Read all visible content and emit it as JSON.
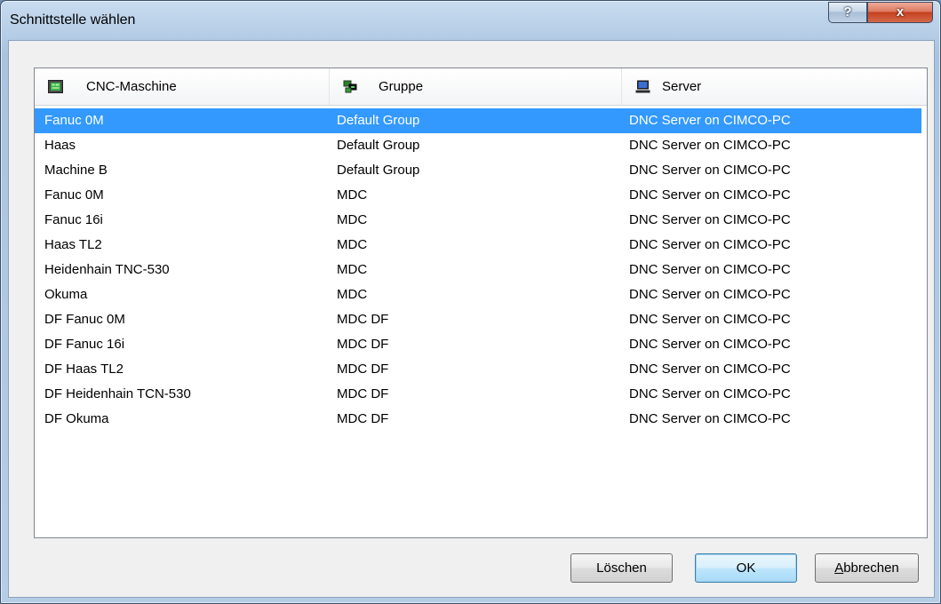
{
  "window": {
    "title": "Schnittstelle wählen",
    "help_label": "?",
    "close_label": "x"
  },
  "columns": [
    {
      "label": "CNC-Maschine",
      "icon": "cnc-machine-icon"
    },
    {
      "label": "Gruppe",
      "icon": "group-icon"
    },
    {
      "label": "Server",
      "icon": "computer-icon"
    }
  ],
  "rows": [
    {
      "machine": "Fanuc 0M",
      "group": "Default Group",
      "server": "DNC Server on CIMCO-PC"
    },
    {
      "machine": "Haas",
      "group": "Default Group",
      "server": "DNC Server on CIMCO-PC"
    },
    {
      "machine": "Machine B",
      "group": "Default Group",
      "server": "DNC Server on CIMCO-PC"
    },
    {
      "machine": "Fanuc 0M",
      "group": "MDC",
      "server": "DNC Server on CIMCO-PC"
    },
    {
      "machine": "Fanuc 16i",
      "group": "MDC",
      "server": "DNC Server on CIMCO-PC"
    },
    {
      "machine": "Haas TL2",
      "group": "MDC",
      "server": "DNC Server on CIMCO-PC"
    },
    {
      "machine": "Heidenhain TNC-530",
      "group": "MDC",
      "server": "DNC Server on CIMCO-PC"
    },
    {
      "machine": "Okuma",
      "group": "MDC",
      "server": "DNC Server on CIMCO-PC"
    },
    {
      "machine": "DF Fanuc 0M",
      "group": "MDC DF",
      "server": "DNC Server on CIMCO-PC"
    },
    {
      "machine": "DF Fanuc 16i",
      "group": "MDC DF",
      "server": "DNC Server on CIMCO-PC"
    },
    {
      "machine": "DF Haas TL2",
      "group": "MDC DF",
      "server": "DNC Server on CIMCO-PC"
    },
    {
      "machine": "DF Heidenhain TCN-530",
      "group": "MDC DF",
      "server": "DNC Server on CIMCO-PC"
    },
    {
      "machine": "DF Okuma",
      "group": "MDC DF",
      "server": "DNC Server on CIMCO-PC"
    }
  ],
  "selected_row": 0,
  "buttons": {
    "delete": "Löschen",
    "ok": "OK",
    "cancel": "Abbrechen"
  },
  "colors": {
    "selection": "#3399ff",
    "close_button": "#c4401f"
  }
}
